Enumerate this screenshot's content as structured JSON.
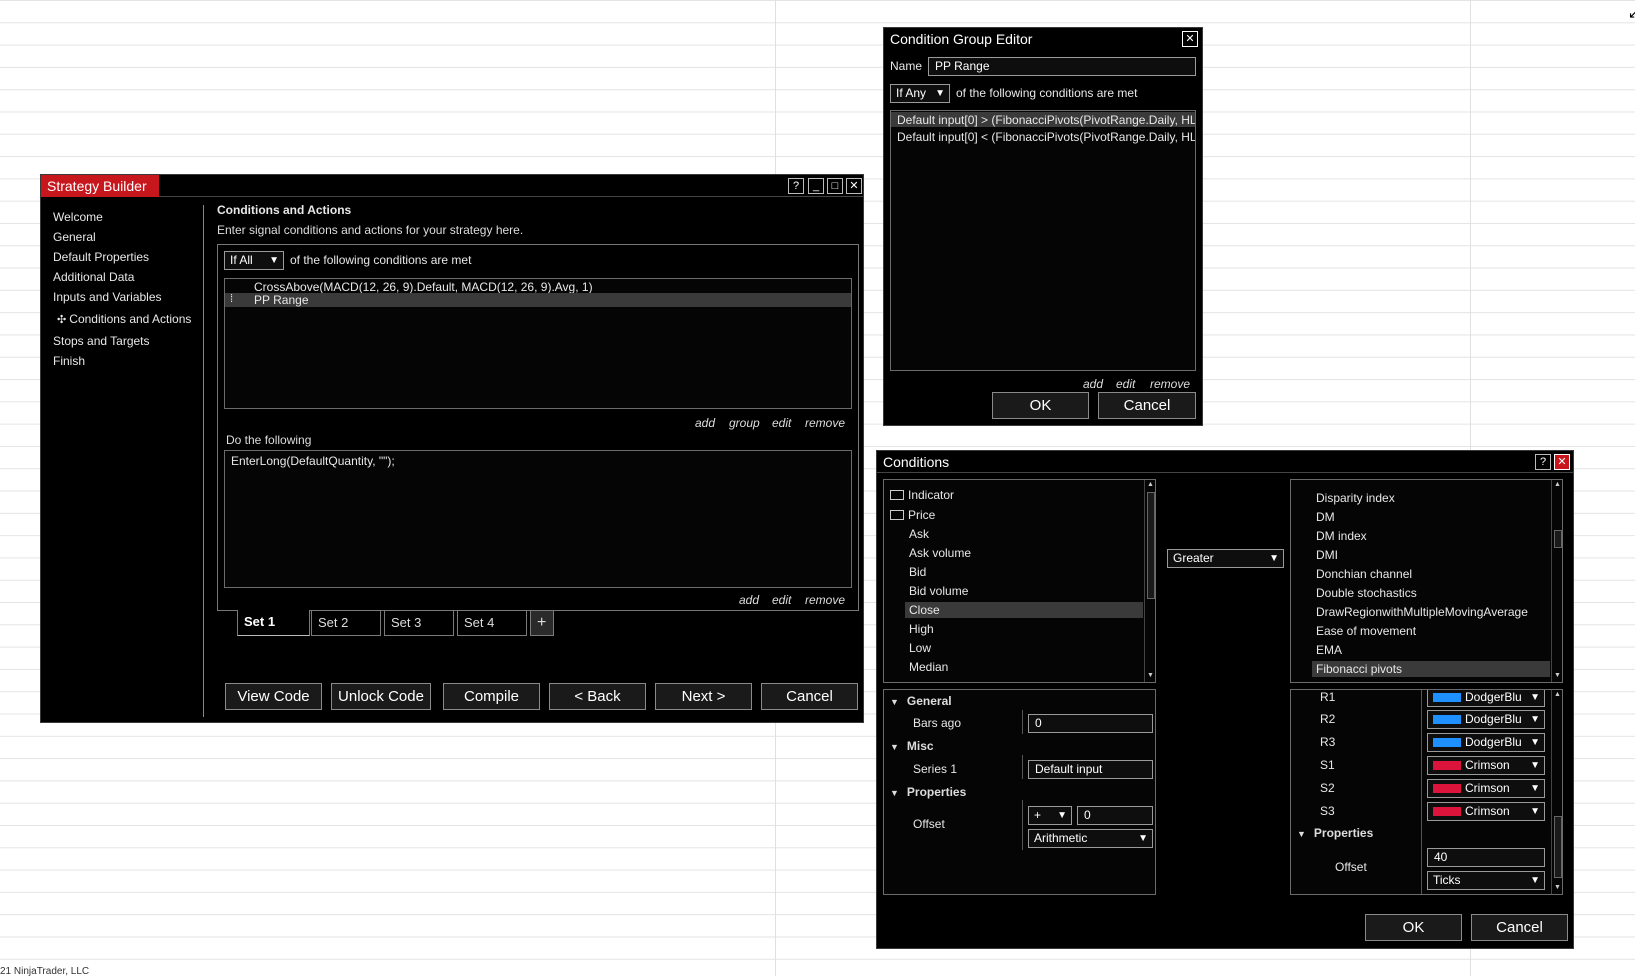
{
  "footer": "21 NinjaTrader, LLC",
  "strategy_builder": {
    "title": "Strategy Builder",
    "help_icon": "?",
    "nav": [
      "Welcome",
      "General",
      "Default Properties",
      "Additional Data",
      "Inputs and Variables",
      "Conditions and Actions",
      "Stops and Targets",
      "Finish"
    ],
    "heading": "Conditions and Actions",
    "subheading": "Enter signal conditions and actions for your strategy here.",
    "match_select": "If All",
    "match_text": "of the following conditions are met",
    "conditions": [
      "CrossAbove(MACD(12, 26, 9).Default, MACD(12, 26, 9).Avg, 1)",
      "PP Range"
    ],
    "cond_links": [
      "add",
      "group",
      "edit",
      "remove"
    ],
    "do_following": "Do the following",
    "actions": [
      "EnterLong(DefaultQuantity, \"\");"
    ],
    "action_links": [
      "add",
      "edit",
      "remove"
    ],
    "tabs": [
      "Set 1",
      "Set 2",
      "Set 3",
      "Set 4"
    ],
    "tab_add": "+",
    "buttons": [
      "View Code",
      "Unlock Code",
      "Compile",
      "< Back",
      "Next >",
      "Cancel"
    ]
  },
  "group_editor": {
    "title": "Condition Group Editor",
    "name_label": "Name",
    "name_value": "PP Range",
    "match_select": "If Any",
    "match_text": "of the following conditions are met",
    "conditions": [
      "Default input[0] > (FibonacciPivots(PivotRange.Daily, HL",
      "Default input[0] < (FibonacciPivots(PivotRange.Daily, HL"
    ],
    "links": [
      "add",
      "edit",
      "remove"
    ],
    "ok": "OK",
    "cancel": "Cancel"
  },
  "conditions_win": {
    "title": "Conditions",
    "help_icon": "?",
    "left_tree": {
      "folders": [
        "Indicator",
        "Price"
      ],
      "items": [
        "Ask",
        "Ask volume",
        "Bid",
        "Bid volume",
        "Close",
        "High",
        "Low",
        "Median"
      ],
      "selected": "Close"
    },
    "operator": "Greater",
    "right_list": {
      "items": [
        "Disparity index",
        "DM",
        "DM index",
        "DMI",
        "Donchian channel",
        "Double stochastics",
        "DrawRegionwithMultipleMovingAverage",
        "Ease of movement",
        "EMA",
        "Fibonacci pivots"
      ],
      "selected": "Fibonacci pivots"
    },
    "left_props": {
      "general": "General",
      "bars_ago_label": "Bars ago",
      "bars_ago": "0",
      "misc": "Misc",
      "series_label": "Series 1",
      "series": "Default input",
      "properties": "Properties",
      "offset_label": "Offset",
      "offset_op": "+",
      "offset_value": "0",
      "offset_type": "Arithmetic"
    },
    "right_props": {
      "plots": [
        {
          "label": "R1",
          "color": "#1e90ff",
          "name": "DodgerBlu"
        },
        {
          "label": "R2",
          "color": "#1e90ff",
          "name": "DodgerBlu"
        },
        {
          "label": "R3",
          "color": "#1e90ff",
          "name": "DodgerBlu"
        },
        {
          "label": "S1",
          "color": "#dc143c",
          "name": "Crimson"
        },
        {
          "label": "S2",
          "color": "#dc143c",
          "name": "Crimson"
        },
        {
          "label": "S3",
          "color": "#dc143c",
          "name": "Crimson"
        }
      ],
      "properties": "Properties",
      "offset_label": "Offset",
      "offset_value": "40",
      "offset_type": "Ticks"
    },
    "ok": "OK",
    "cancel": "Cancel"
  },
  "colors": {
    "title_red": "#c8161d",
    "selection": "#3a3a3a"
  }
}
